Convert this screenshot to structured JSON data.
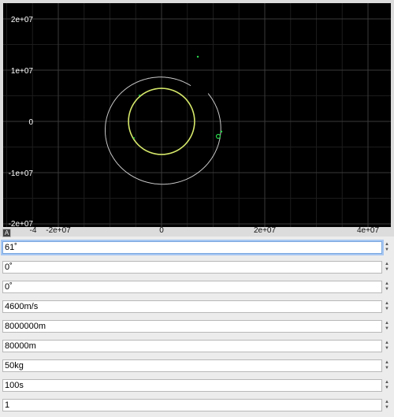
{
  "plot": {
    "x_ticks": [
      {
        "value": -20000000,
        "label": "-2e+07"
      },
      {
        "value": 0,
        "label": "0"
      },
      {
        "value": 20000000,
        "label": "2e+07"
      },
      {
        "value": 40000000,
        "label": "4e+07"
      }
    ],
    "y_ticks": [
      {
        "value": 20000000,
        "label": "2e+07"
      },
      {
        "value": 10000000,
        "label": "1e+07"
      },
      {
        "value": 0,
        "label": "0"
      },
      {
        "value": -10000000,
        "label": "-1e+07"
      },
      {
        "value": -20000000,
        "label": "-2e+07"
      }
    ],
    "x_edge_label": "-4",
    "xlim": [
      -25000000,
      45000000
    ],
    "ylim": [
      -20000000,
      23000000
    ],
    "planet_radius_m": 6400000,
    "colors": {
      "background": "#000000",
      "grid": "#3a3a3a",
      "planet": "#d6e86a",
      "trajectory": "#c8c8c8",
      "marker": "#29d44a"
    },
    "corner_label": "A"
  },
  "fields": [
    {
      "value": "61˚"
    },
    {
      "value": "0˚"
    },
    {
      "value": "0˚"
    },
    {
      "value": "4600m/s"
    },
    {
      "value": "8000000m"
    },
    {
      "value": "80000m"
    },
    {
      "value": "50kg"
    },
    {
      "value": "100s"
    },
    {
      "value": "1"
    }
  ]
}
